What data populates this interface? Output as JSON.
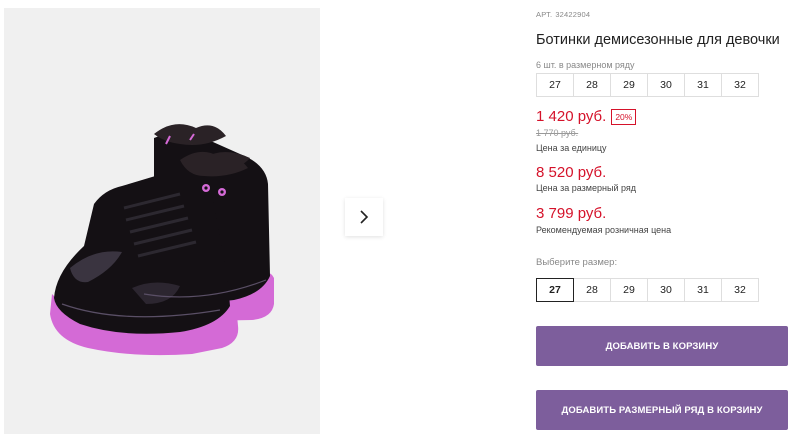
{
  "product": {
    "sku_label": "АРТ.",
    "sku": "32422904",
    "title": "Ботинки демисезонные для девочки"
  },
  "size_row": {
    "caption": "6 шт. в размерном ряду",
    "sizes": [
      "27",
      "28",
      "29",
      "30",
      "31",
      "32"
    ]
  },
  "pricing": {
    "unit_price": "1 420 руб.",
    "discount": "20%",
    "old_price": "1 770 руб.",
    "unit_caption": "Цена за единицу",
    "row_price": "8 520 руб.",
    "row_caption": "Цена за размерный ряд",
    "retail_price": "3 799 руб.",
    "retail_caption": "Рекомендуемая розничная цена"
  },
  "size_picker": {
    "label": "Выберите размер:",
    "sizes": [
      "27",
      "28",
      "29",
      "30",
      "31",
      "32"
    ],
    "selected": "27"
  },
  "actions": {
    "add_to_cart": "ДОБАВИТЬ В КОРЗИНУ",
    "add_row_to_cart": "ДОБАВИТЬ РАЗМЕРНЫЙ РЯД В КОРЗИНУ"
  },
  "colors": {
    "accent": "#7d5e9c",
    "price": "#d5122a",
    "boot_sole": "#d46ad6",
    "boot_body": "#141014"
  },
  "icons": {
    "gallery_next": "chevron-right-icon"
  }
}
